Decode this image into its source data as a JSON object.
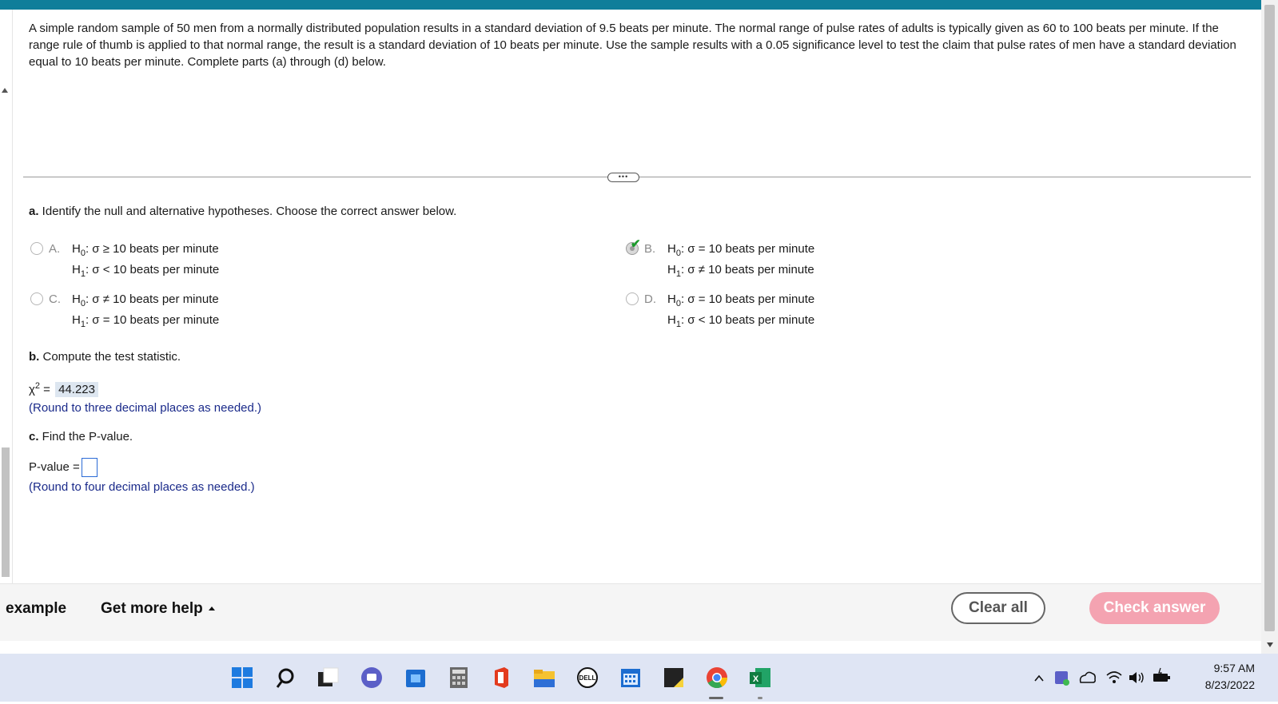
{
  "question": {
    "text": "A simple random sample of 50 men from a normally distributed population results in a standard deviation of 9.5 beats per minute. The normal range of pulse rates of adults is typically given as 60 to 100 beats per minute. If the range rule of thumb is applied to that normal range, the result is a standard deviation of 10 beats per minute. Use the sample results with a 0.05 significance level to test the claim that pulse rates of men have a standard deviation equal to 10 beats per minute. Complete parts (a) through (d) below."
  },
  "divider": {
    "handle_label": "•••"
  },
  "part_a": {
    "label_bold": "a.",
    "label_text": " Identify the null and alternative hypotheses. Choose the correct answer below.",
    "options": [
      {
        "letter": "A.",
        "h0_prefix": "H",
        "h0_sub": "0",
        "h0_rest": ": σ ≥ 10 beats per minute",
        "h1_prefix": "H",
        "h1_sub": "1",
        "h1_rest": ": σ < 10 beats per minute"
      },
      {
        "letter": "B.",
        "h0_prefix": "H",
        "h0_sub": "0",
        "h0_rest": ": σ = 10 beats per minute",
        "h1_prefix": "H",
        "h1_sub": "1",
        "h1_rest": ": σ ≠ 10 beats per minute"
      },
      {
        "letter": "C.",
        "h0_prefix": "H",
        "h0_sub": "0",
        "h0_rest": ": σ ≠ 10 beats per minute",
        "h1_prefix": "H",
        "h1_sub": "1",
        "h1_rest": ": σ = 10 beats per minute"
      },
      {
        "letter": "D.",
        "h0_prefix": "H",
        "h0_sub": "0",
        "h0_rest": ": σ = 10 beats per minute",
        "h1_prefix": "H",
        "h1_sub": "1",
        "h1_rest": ": σ < 10 beats per minute"
      }
    ],
    "selected": "B.",
    "correct_mark": "✔"
  },
  "part_b": {
    "label_bold": "b.",
    "label_text": " Compute the test statistic.",
    "symbol": "χ",
    "symbol_sup": "2",
    "equals": " = ",
    "value": "44.223",
    "hint": "(Round to three decimal places as needed.)"
  },
  "part_c": {
    "label_bold": "c.",
    "label_text": " Find the P-value.",
    "input_label": "P-value =",
    "input_value": "",
    "hint": "(Round to four decimal places as needed.)"
  },
  "footer": {
    "example_label": "example",
    "help_label": "Get more help",
    "clear_label": "Clear all",
    "check_label": "Check answer"
  },
  "taskbar": {
    "icons": [
      "windows-start-icon",
      "search-icon",
      "task-view-icon",
      "chat-icon",
      "store-icon",
      "calculator-icon",
      "office-icon",
      "file-explorer-icon",
      "dell-icon",
      "calendar-icon",
      "sticky-notes-icon",
      "chrome-icon",
      "excel-icon"
    ],
    "tray_icons": [
      "chevron-up-icon",
      "teams-icon",
      "onedrive-icon",
      "wifi-icon",
      "volume-icon",
      "battery-icon"
    ],
    "time": "9:57 AM",
    "date": "8/23/2022"
  },
  "colors": {
    "top_bar": "#0f7e9a",
    "check_button": "#f4a3b1",
    "hint_text": "#1a2a8a",
    "correct_check": "#1a9a2a"
  }
}
